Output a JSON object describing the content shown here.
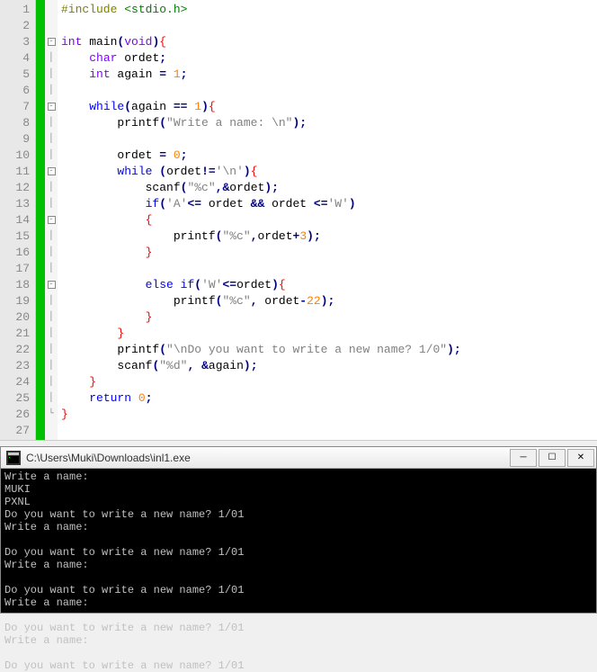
{
  "editor": {
    "lineNumbers": [
      "1",
      "2",
      "3",
      "4",
      "5",
      "6",
      "7",
      "8",
      "9",
      "10",
      "11",
      "12",
      "13",
      "14",
      "15",
      "16",
      "17",
      "18",
      "19",
      "20",
      "21",
      "22",
      "23",
      "24",
      "25",
      "26",
      "27"
    ],
    "foldMarkers": {
      "3": "box",
      "7": "box",
      "11": "box",
      "14": "box",
      "18": "box"
    },
    "code": {
      "l1": {
        "pp": "#include",
        "inc": " <stdio.h>"
      },
      "l3_a": "int",
      "l3_b": " main",
      "l3_c": "(",
      "l3_d": "void",
      "l3_e": ")",
      "l3_f": "{",
      "l4_a": "char",
      "l4_b": " ordet",
      "l4_c": ";",
      "l5_a": "int",
      "l5_b": " again ",
      "l5_c": "=",
      "l5_d": " ",
      "l5_e": "1",
      "l5_f": ";",
      "l7_a": "while",
      "l7_b": "(",
      "l7_c": "again ",
      "l7_d": "==",
      "l7_e": " ",
      "l7_f": "1",
      "l7_g": ")",
      "l7_h": "{",
      "l8_a": "printf",
      "l8_b": "(",
      "l8_c": "\"Write a name: \\n\"",
      "l8_d": ")",
      "l8_e": ";",
      "l10_a": "ordet ",
      "l10_b": "=",
      "l10_c": " ",
      "l10_d": "0",
      "l10_e": ";",
      "l11_a": "while",
      "l11_b": " ",
      "l11_c": "(",
      "l11_d": "ordet",
      "l11_e": "!=",
      "l11_f": "'\\n'",
      "l11_g": ")",
      "l11_h": "{",
      "l12_a": "scanf",
      "l12_b": "(",
      "l12_c": "\"%c\"",
      "l12_d": ",",
      "l12_e": "&",
      "l12_f": "ordet",
      "l12_g": ")",
      "l12_h": ";",
      "l13_a": "if",
      "l13_b": "(",
      "l13_c": "'A'",
      "l13_d": "<=",
      "l13_e": " ordet ",
      "l13_f": "&&",
      "l13_g": " ordet ",
      "l13_h": "<=",
      "l13_i": "'W'",
      "l13_j": ")",
      "l14_a": "{",
      "l15_a": "printf",
      "l15_b": "(",
      "l15_c": "\"%c\"",
      "l15_d": ",",
      "l15_e": "ordet",
      "l15_f": "+",
      "l15_g": "3",
      "l15_h": ")",
      "l15_i": ";",
      "l16_a": "}",
      "l18_a": "else",
      "l18_b": " ",
      "l18_c": "if",
      "l18_d": "(",
      "l18_e": "'W'",
      "l18_f": "<=",
      "l18_g": "ordet",
      "l18_h": ")",
      "l18_i": "{",
      "l19_a": "printf",
      "l19_b": "(",
      "l19_c": "\"%c\"",
      "l19_d": ",",
      "l19_e": " ordet",
      "l19_f": "-",
      "l19_g": "22",
      "l19_h": ")",
      "l19_i": ";",
      "l20_a": "}",
      "l21_a": "}",
      "l22_a": "printf",
      "l22_b": "(",
      "l22_c": "\"\\nDo you want to write a new name? 1/0\"",
      "l22_d": ")",
      "l22_e": ";",
      "l23_a": "scanf",
      "l23_b": "(",
      "l23_c": "\"%d\"",
      "l23_d": ",",
      "l23_e": " ",
      "l23_f": "&",
      "l23_g": "again",
      "l23_h": ")",
      "l23_i": ";",
      "l24_a": "}",
      "l25_a": "return",
      "l25_b": " ",
      "l25_c": "0",
      "l25_d": ";",
      "l26_a": "}"
    }
  },
  "console": {
    "title": "C:\\Users\\Muki\\Downloads\\inl1.exe",
    "output": "Write a name:\nMUKI\nPXNL\nDo you want to write a new name? 1/01\nWrite a name:\n\nDo you want to write a new name? 1/01\nWrite a name:\n\nDo you want to write a new name? 1/01\nWrite a name:\n\nDo you want to write a new name? 1/01\nWrite a name:\n\nDo you want to write a new name? 1/01"
  },
  "windowControls": {
    "minimize": "─",
    "maximize": "☐",
    "close": "✕"
  }
}
